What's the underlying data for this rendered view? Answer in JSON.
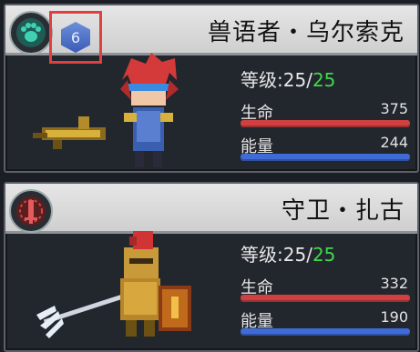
{
  "colors": {
    "hp_bar": "#d04040",
    "energy_bar": "#3f6bd6",
    "max_level": "#41d84b",
    "badge_highlight": "#e14040",
    "title_bar": "#e0e0e0"
  },
  "heroes": [
    {
      "name": "兽语者・乌尔索克",
      "emblem_icon": "paw-icon",
      "badge": "6",
      "level_label": "等级",
      "level": "25",
      "level_sep": "/",
      "level_max": "25",
      "hp_label": "生命",
      "hp": "375",
      "energy_label": "能量",
      "energy": "244"
    },
    {
      "name": "守卫・扎古",
      "emblem_icon": "blade-icon",
      "level_label": "等级",
      "level": "25",
      "level_sep": "/",
      "level_max": "25",
      "hp_label": "生命",
      "hp": "332",
      "energy_label": "能量",
      "energy": "190"
    }
  ]
}
